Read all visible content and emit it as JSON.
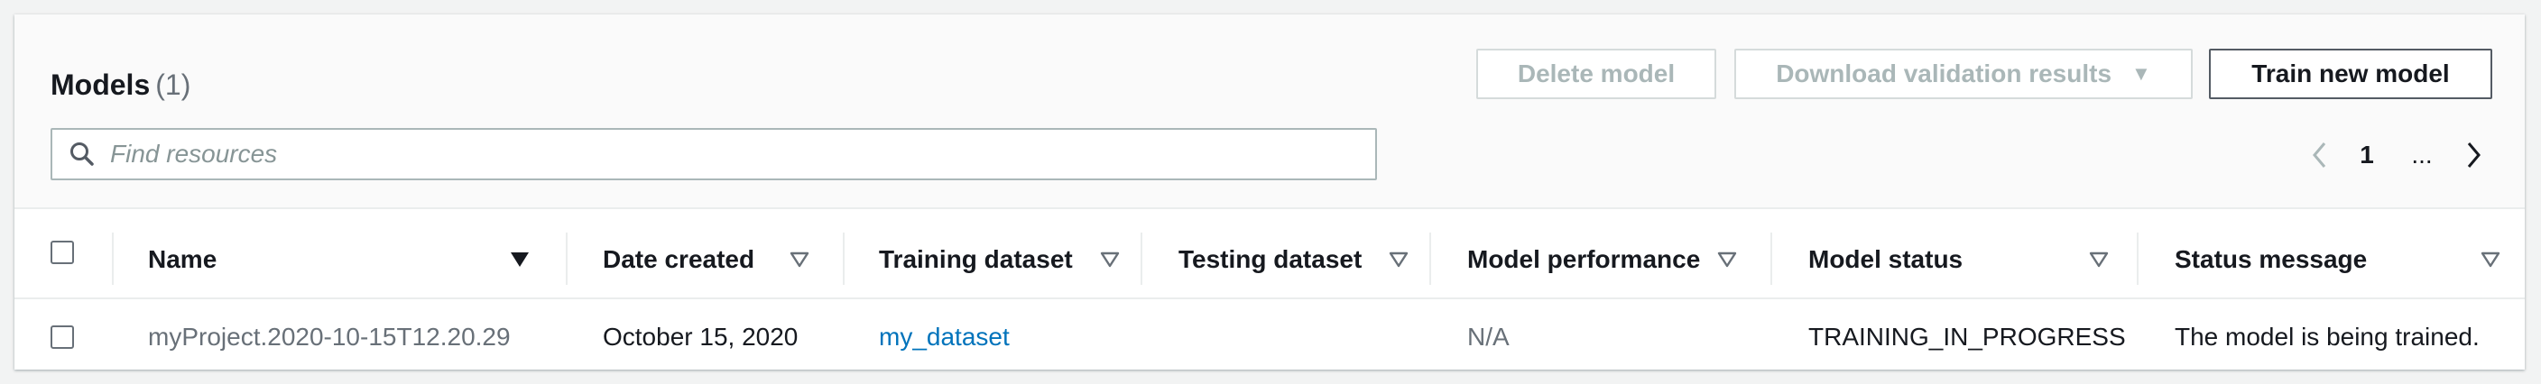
{
  "header": {
    "title": "Models",
    "count": "(1)"
  },
  "toolbar": {
    "delete_label": "Delete model",
    "download_label": "Download validation results",
    "train_label": "Train new model"
  },
  "search": {
    "placeholder": "Find resources",
    "value": ""
  },
  "pagination": {
    "current_page": "1",
    "ellipsis": "..."
  },
  "table": {
    "columns": [
      {
        "label": "Name",
        "sorted": true
      },
      {
        "label": "Date created"
      },
      {
        "label": "Training dataset"
      },
      {
        "label": "Testing dataset"
      },
      {
        "label": "Model performance"
      },
      {
        "label": "Model status"
      },
      {
        "label": "Status message"
      }
    ],
    "rows": [
      {
        "name": "myProject.2020-10-15T12.20.29",
        "date_created": "October 15, 2020",
        "training_dataset": "my_dataset",
        "testing_dataset": "",
        "model_performance": "N/A",
        "model_status": "TRAINING_IN_PROGRESS",
        "status_message": "The model is being trained."
      }
    ]
  },
  "colors": {
    "link": "#0073bb",
    "disabled_text": "#aab7b8",
    "header_bg": "#fafafa",
    "page_bg": "#f2f3f3"
  }
}
